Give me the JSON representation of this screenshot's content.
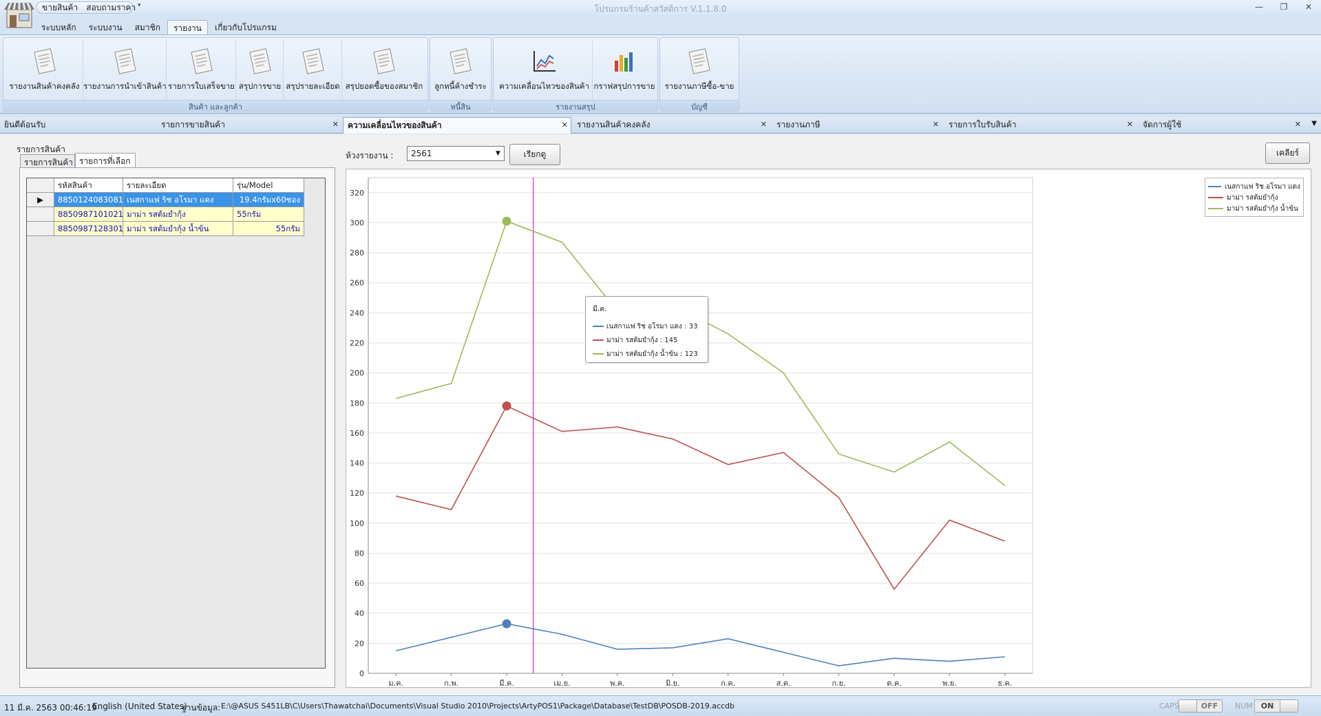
{
  "app": {
    "title": "โปรแกรมร้านค้าสวัสดิการ V.1.1.8.0",
    "quick_access": [
      "ขายสินค้า",
      "สอบถามราคา"
    ]
  },
  "ribbon_tabs": [
    "ระบบหลัก",
    "ระบบงาน",
    "สมาชิก",
    "รายงาน",
    "เกี่ยวกับโปรแกรม"
  ],
  "ribbon_active_tab": "รายงาน",
  "ribbon_groups": [
    {
      "label": "สินค้า และลูกค้า",
      "buttons": [
        "รายงานสินค้าคงคลัง",
        "รายงานการนำเข้าสินค้า",
        "รายการใบเสร็จขาย",
        "สรุปการขาย",
        "สรุปรายละเอียด",
        "สรุปยอดซื้อของสมาชิก"
      ]
    },
    {
      "label": "หนี้สิน",
      "buttons": [
        "ลูกหนี้ค้างชำระ"
      ]
    },
    {
      "label": "รายงานสรุป",
      "buttons": [
        "ความเคลื่อนไหวของสินค้า",
        "กราฟสรุปการขาย"
      ]
    },
    {
      "label": "บัญชี",
      "buttons": [
        "รายงานภาษีซื้อ-ขาย"
      ]
    }
  ],
  "doc_tabs": [
    {
      "label": "ยินดีต้อนรับ",
      "closable": false
    },
    {
      "label": "รายการขายสินค้า",
      "closable": true
    },
    {
      "label": "ความเคลื่อนไหวของสินค้า",
      "closable": true,
      "active": true
    },
    {
      "label": "รายงานสินค้าคงคลัง",
      "closable": true
    },
    {
      "label": "รายงานภาษี",
      "closable": true
    },
    {
      "label": "รายการใบรับสินค้า",
      "closable": true
    },
    {
      "label": "จัดการผู้ใช้",
      "closable": true
    }
  ],
  "left_panel": {
    "title": "รายการสินค้า",
    "subtabs": [
      "รายการสินค้า",
      "รายการที่เลือก"
    ],
    "active_subtab": "รายการที่เลือก",
    "columns": [
      "รหัสสินค้า",
      "รายละเอียด",
      "รุ่น/Model"
    ],
    "rows": [
      {
        "code": "8850124083081",
        "desc": "เนสกาแฟ ริช อโรมา แดง",
        "model": "19.4กรัมx60ซอง",
        "selected": true
      },
      {
        "code": "8850987101021",
        "desc": "มาม่า รสต้มยำกุ้ง",
        "model": "55กรัม",
        "selected": false
      },
      {
        "code": "8850987128301",
        "desc": "มาม่า รสต้มยำกุ้ง น้ำข้น",
        "model": "55กรัม",
        "selected": false
      }
    ]
  },
  "toolbar": {
    "period_label": "ห้วงรายงาน :",
    "period_value": "2561",
    "query_button": "เรียกดู",
    "clear_button": "เคลียร์"
  },
  "chart_data": {
    "type": "line",
    "categories": [
      "ม.ค.",
      "ก.พ.",
      "มี.ค.",
      "เม.ย.",
      "พ.ค.",
      "มิ.ย.",
      "ก.ค.",
      "ส.ค.",
      "ก.ย.",
      "ต.ค.",
      "พ.ย.",
      "ธ.ค."
    ],
    "ylim": [
      0,
      330
    ],
    "yticks": [
      0,
      20,
      40,
      60,
      80,
      100,
      120,
      140,
      160,
      180,
      200,
      220,
      240,
      260,
      280,
      300,
      320
    ],
    "grid": true,
    "legend_position": "top-right",
    "series": [
      {
        "name": "เนสกาแฟ ริช อโรมา แดง",
        "color": "#4f81bd",
        "values": [
          15,
          24,
          33,
          26,
          16,
          17,
          23,
          14,
          5,
          10,
          8,
          11
        ]
      },
      {
        "name": "มาม่า รสต้มยำกุ้ง",
        "color": "#c0504d",
        "values": [
          118,
          109,
          178,
          161,
          164,
          156,
          139,
          147,
          117,
          56,
          102,
          88
        ]
      },
      {
        "name": "มาม่า รสต้มยำกุ้ง น้ำข้น",
        "color": "#9bbb59",
        "values": [
          183,
          193,
          301,
          287,
          241,
          245,
          226,
          200,
          146,
          134,
          154,
          125
        ]
      }
    ],
    "highlight_index": 2,
    "crosshair_color": "#d12fc0",
    "tooltip": {
      "title": "มี.ค.",
      "items": [
        "เนสกาแฟ ริช อโรมา แดง : 33",
        "มาม่า รสต้มยำกุ้ง : 145",
        "มาม่า รสต้มยำกุ้ง น้ำข้น : 123"
      ]
    }
  },
  "statusbar": {
    "datetime": "11 มี.ค. 2563  00:46:19",
    "language": "English (United States)",
    "db_label": "ฐานข้อมูล:",
    "db_path": "E:\\@ASUS S451LB\\C\\Users\\Thawatchai\\Documents\\Visual Studio 2010\\Projects\\ArtyPOS1\\Package\\Database\\TestDB\\POSDB-2019.accdb",
    "caps_label": "CAPS",
    "caps_value": "OFF",
    "num_label": "NUM",
    "num_value": "ON"
  }
}
